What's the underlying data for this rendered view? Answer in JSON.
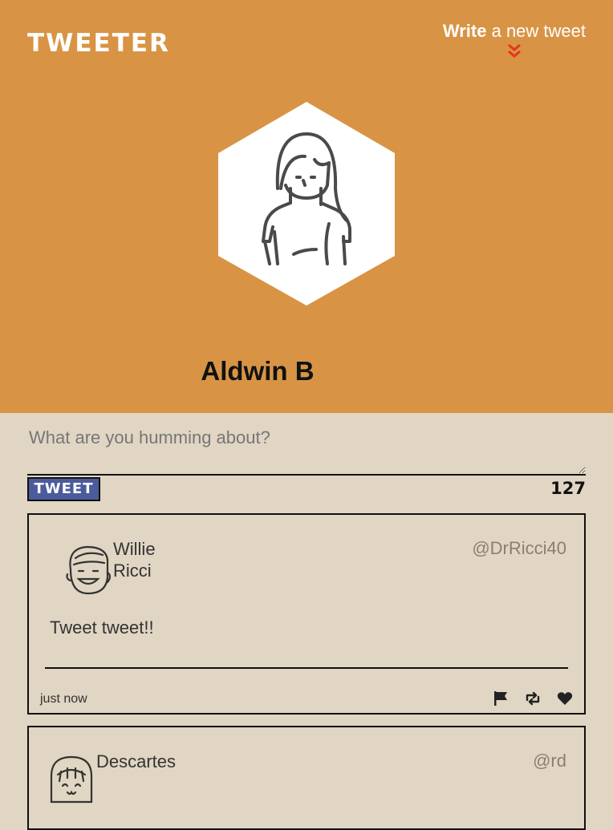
{
  "nav": {
    "brand": "TWEETER",
    "compose_strong": "Write",
    "compose_rest": " a new tweet",
    "accent_color": "#d89444",
    "chevron_color": "#e8341c"
  },
  "profile": {
    "name": "Aldwin B",
    "avatar_icon": "woman-avatar-icon"
  },
  "composer": {
    "placeholder": "What are you humming about?",
    "button_label": "TWEET",
    "char_count": "127"
  },
  "tweets": [
    {
      "name": "Willie Ricci",
      "handle": "@DrRicci40",
      "body": "Tweet tweet!!",
      "time": "just now",
      "avatar_icon": "man-avatar-icon"
    },
    {
      "name": "Descartes",
      "handle": "@rd",
      "avatar_icon": "girl-avatar-icon"
    }
  ],
  "action_icons": [
    "flag-icon",
    "retweet-icon",
    "heart-icon"
  ]
}
